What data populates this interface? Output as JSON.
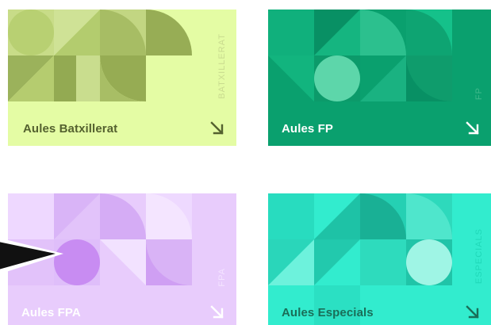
{
  "cards": [
    {
      "label": "Aules Batxillerat",
      "vertical_text": "BATXILLERAT",
      "background": "#e4fca4",
      "label_color": "#54612f",
      "vertical_color": "#c9db8f",
      "arrow_color": "#54612f",
      "icon": "arrow-down-right-icon"
    },
    {
      "label": "Aules FP",
      "vertical_text": "FP",
      "background": "#0aa06e",
      "label_color": "#ffffff",
      "vertical_color": "#3fb98b",
      "arrow_color": "#ffffff",
      "icon": "arrow-down-right-icon"
    },
    {
      "label": "Aules FPA",
      "vertical_text": "FPA",
      "background": "#e8ccfc",
      "label_color": "#ffffff",
      "vertical_color": "#f4e4ff",
      "arrow_color": "#ffffff",
      "icon": "arrow-down-right-icon"
    },
    {
      "label": "Aules Especials",
      "vertical_text": "ESPECIALS",
      "background": "#32ecce",
      "label_color": "#1a6e58",
      "vertical_color": "#1fd8b8",
      "arrow_color": "#1a6e58",
      "icon": "arrow-down-right-icon"
    }
  ],
  "cursor": {
    "icon": "mouse-pointer-icon",
    "color": "#111111"
  }
}
